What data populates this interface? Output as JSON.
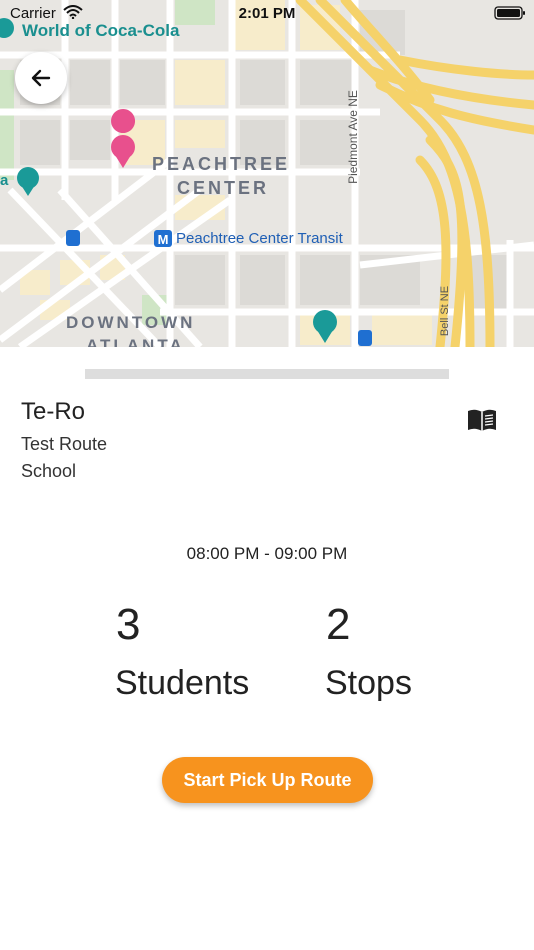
{
  "status_bar": {
    "carrier": "Carrier",
    "time": "2:01 PM"
  },
  "map": {
    "labels": {
      "world_of_coca_cola": "World of Coca-Cola",
      "peachtree_line1": "PEACHTREE",
      "peachtree_line2": "CENTER",
      "transit": "Peachtree Center Transit",
      "downtown_line1": "DOWNTOWN",
      "downtown_line2": "ATLANTA",
      "piedmont": "Piedmont Ave NE",
      "bell": "Bell St NE",
      "partial_a": "a"
    },
    "transit_badge": "M"
  },
  "route": {
    "name": "Te-Ro",
    "description": "Test Route",
    "type": "School",
    "time_range": "08:00 PM - 09:00 PM"
  },
  "stats": {
    "students_count": "3",
    "students_label": "Students",
    "stops_count": "2",
    "stops_label": "Stops"
  },
  "actions": {
    "start_label": "Start Pick Up Route"
  },
  "colors": {
    "accent": "#f7931e",
    "map_highway": "#f5d76e",
    "map_block": "#f8efcf",
    "map_park": "#cfe8c4"
  }
}
